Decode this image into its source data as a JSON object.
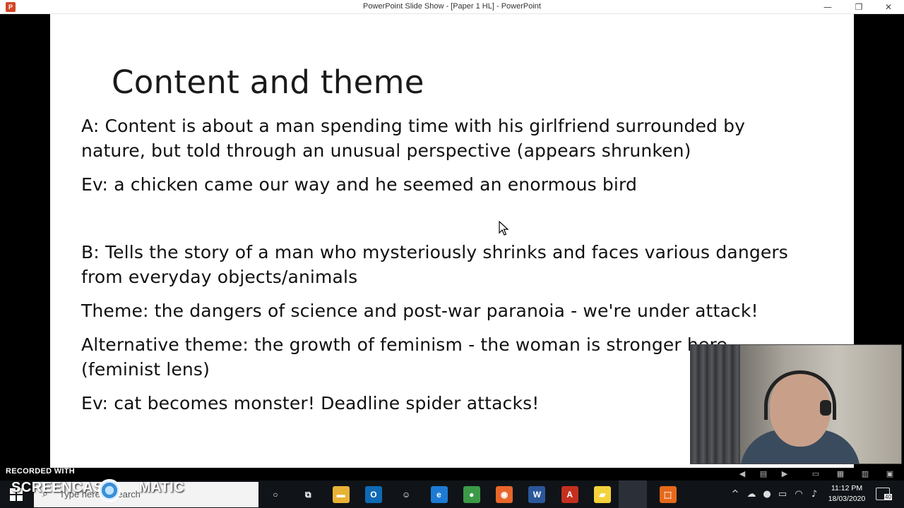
{
  "window": {
    "title": "PowerPoint Slide Show - [Paper 1 HL] - PowerPoint",
    "app_icon_letter": "P",
    "minimize": "—",
    "restore": "❐",
    "close": "✕"
  },
  "slide": {
    "title": "Content and theme",
    "paragraphs": [
      "A: Content is about a man spending time with his girlfriend surrounded by",
      "nature, but told through an unusual perspective (appears shrunken)",
      "Ev: a chicken came our way and he seemed an enormous bird",
      "B: Tells the story of a man who mysteriously shrinks and faces various dangers",
      "from everyday objects/animals",
      "Theme: the dangers of science and post-war paranoia - we're under attack!",
      "Alternative theme: the growth of feminism - the woman is stronger here",
      "(feminist lens)",
      "Ev: cat becomes monster! Deadline spider attacks!"
    ]
  },
  "slideshow_controls": {
    "prev": "◀",
    "notes": "▤",
    "next": "▶",
    "normal_view": "▭",
    "sorter_view": "▦",
    "reading_view": "▥",
    "slideshow_view": "▣"
  },
  "watermark": {
    "line1": "RECORDED WITH",
    "line2": "SCREENCAST",
    "line3": "MATIC"
  },
  "taskbar": {
    "search_placeholder": "Type here to search",
    "apps": [
      {
        "name": "cortana",
        "glyph": "○",
        "color": "#101418"
      },
      {
        "name": "task-view",
        "glyph": "⧉",
        "color": "#101418"
      },
      {
        "name": "file-explorer",
        "glyph": "▬",
        "color": "#e8b335"
      },
      {
        "name": "outlook",
        "glyph": "O",
        "color": "#0f6ab4"
      },
      {
        "name": "unknown-app",
        "glyph": "☺",
        "color": "#101418"
      },
      {
        "name": "edge",
        "glyph": "e",
        "color": "#1e7bd4"
      },
      {
        "name": "chrome",
        "glyph": "●",
        "color": "#3c9a47"
      },
      {
        "name": "firefox",
        "glyph": "◉",
        "color": "#e8662b"
      },
      {
        "name": "word",
        "glyph": "W",
        "color": "#2b579a"
      },
      {
        "name": "acrobat",
        "glyph": "A",
        "color": "#c4301f"
      },
      {
        "name": "sticky-notes",
        "glyph": "▰",
        "color": "#f4d23a"
      },
      {
        "name": "powerpoint",
        "glyph": "P",
        "color": "#d24726"
      },
      {
        "name": "screencast-recorder",
        "glyph": "⬚",
        "color": "#e56a1b"
      }
    ],
    "time": "11:12 PM",
    "date": "18/03/2020",
    "notification_count": "40"
  }
}
